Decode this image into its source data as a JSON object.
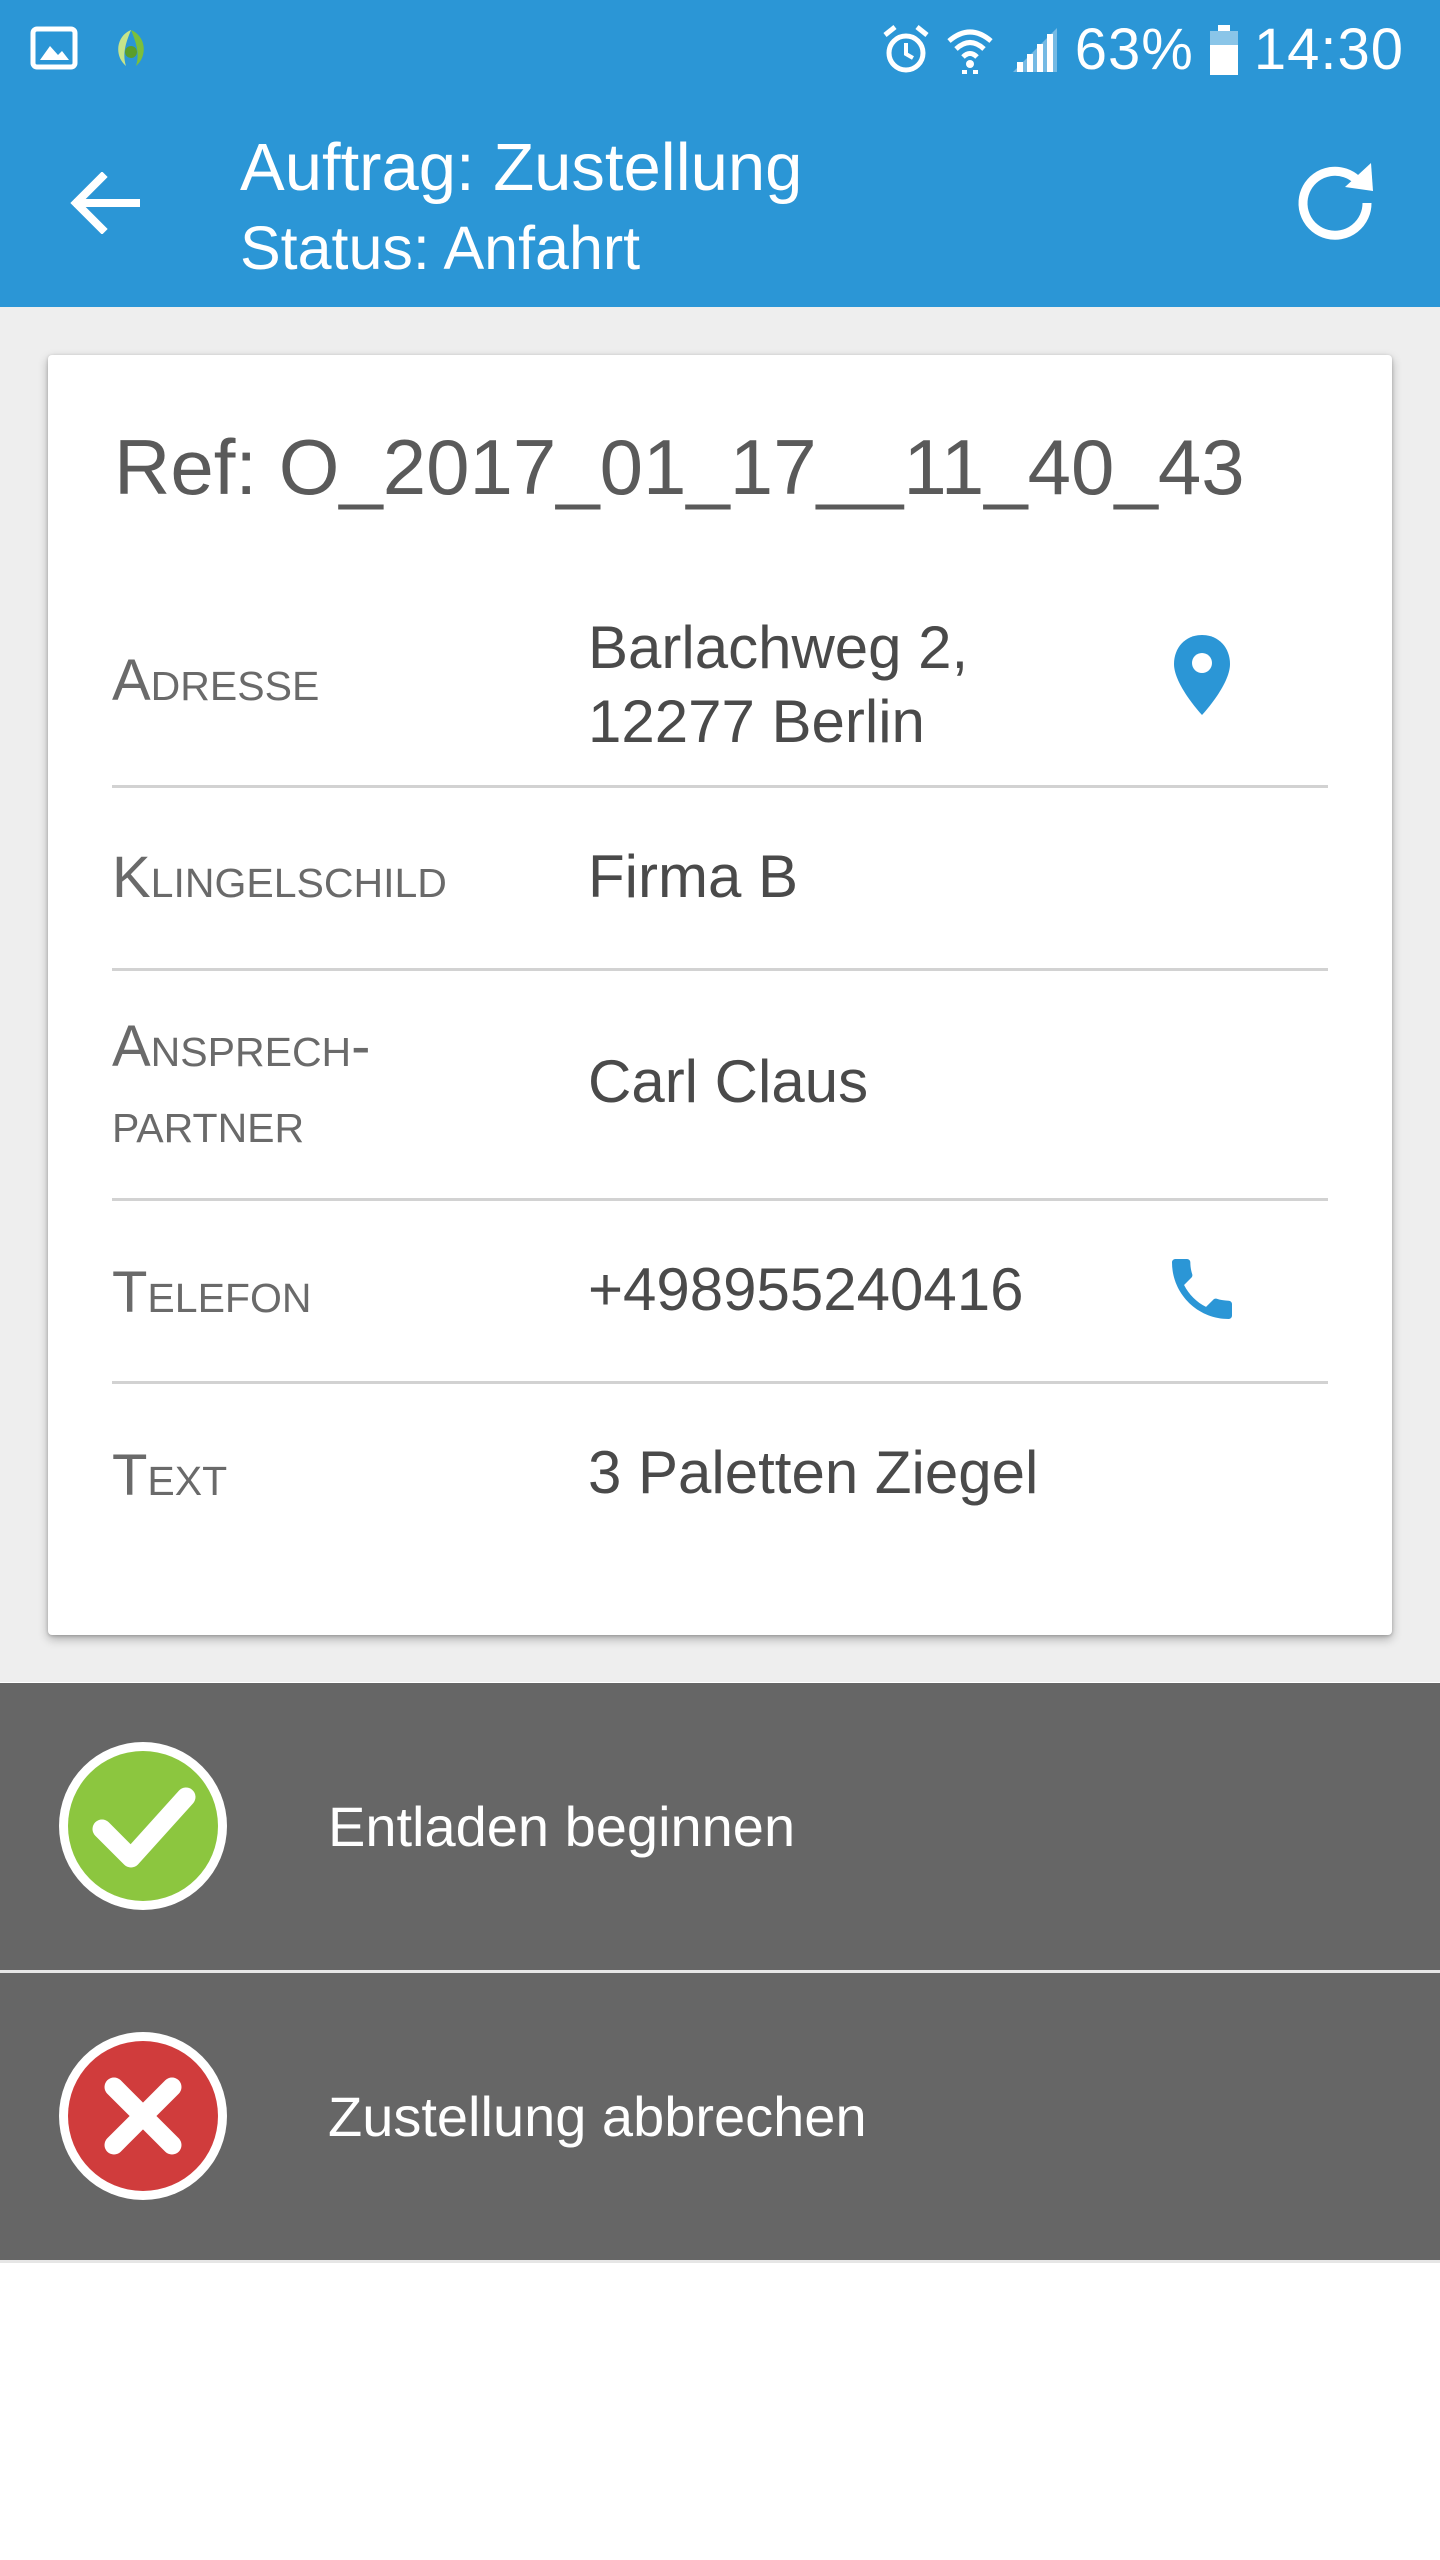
{
  "status_bar": {
    "battery_percent": "63%",
    "time": "14:30",
    "left_icons": [
      "gallery-icon",
      "app-leaf-icon"
    ],
    "right_icons": [
      "alarm-icon",
      "wifi-icon",
      "signal-icon",
      "battery-icon"
    ]
  },
  "app_bar": {
    "title": "Auftrag: Zustellung",
    "subtitle": "Status: Anfahrt",
    "back_icon": "arrow-back-icon",
    "refresh_icon": "refresh-icon"
  },
  "card": {
    "ref": "Ref: O_2017_01_17__11_40_43",
    "rows": [
      {
        "label": "Adresse",
        "value_line1": "Barlachweg 2,",
        "value_line2": "12277 Berlin",
        "action_icon": "map-pin-icon"
      },
      {
        "label": "Klingelschild",
        "value": "Firma B"
      },
      {
        "label_line1": "Ansprech-",
        "label_line2": "partner",
        "value": "Carl Claus"
      },
      {
        "label": "Telefon",
        "value": "+498955240416",
        "action_icon": "phone-icon"
      },
      {
        "label": "Text",
        "value": "3 Paletten Ziegel"
      }
    ]
  },
  "actions": [
    {
      "label": "Entladen beginnen",
      "icon": "check-circle-icon",
      "color": "#8cc63f"
    },
    {
      "label": "Zustellung abbrechen",
      "icon": "cancel-circle-icon",
      "color": "#d03c3c"
    }
  ],
  "colors": {
    "primary": "#2b96d6",
    "action_background": "#666666",
    "content_background": "#eeeeee"
  }
}
